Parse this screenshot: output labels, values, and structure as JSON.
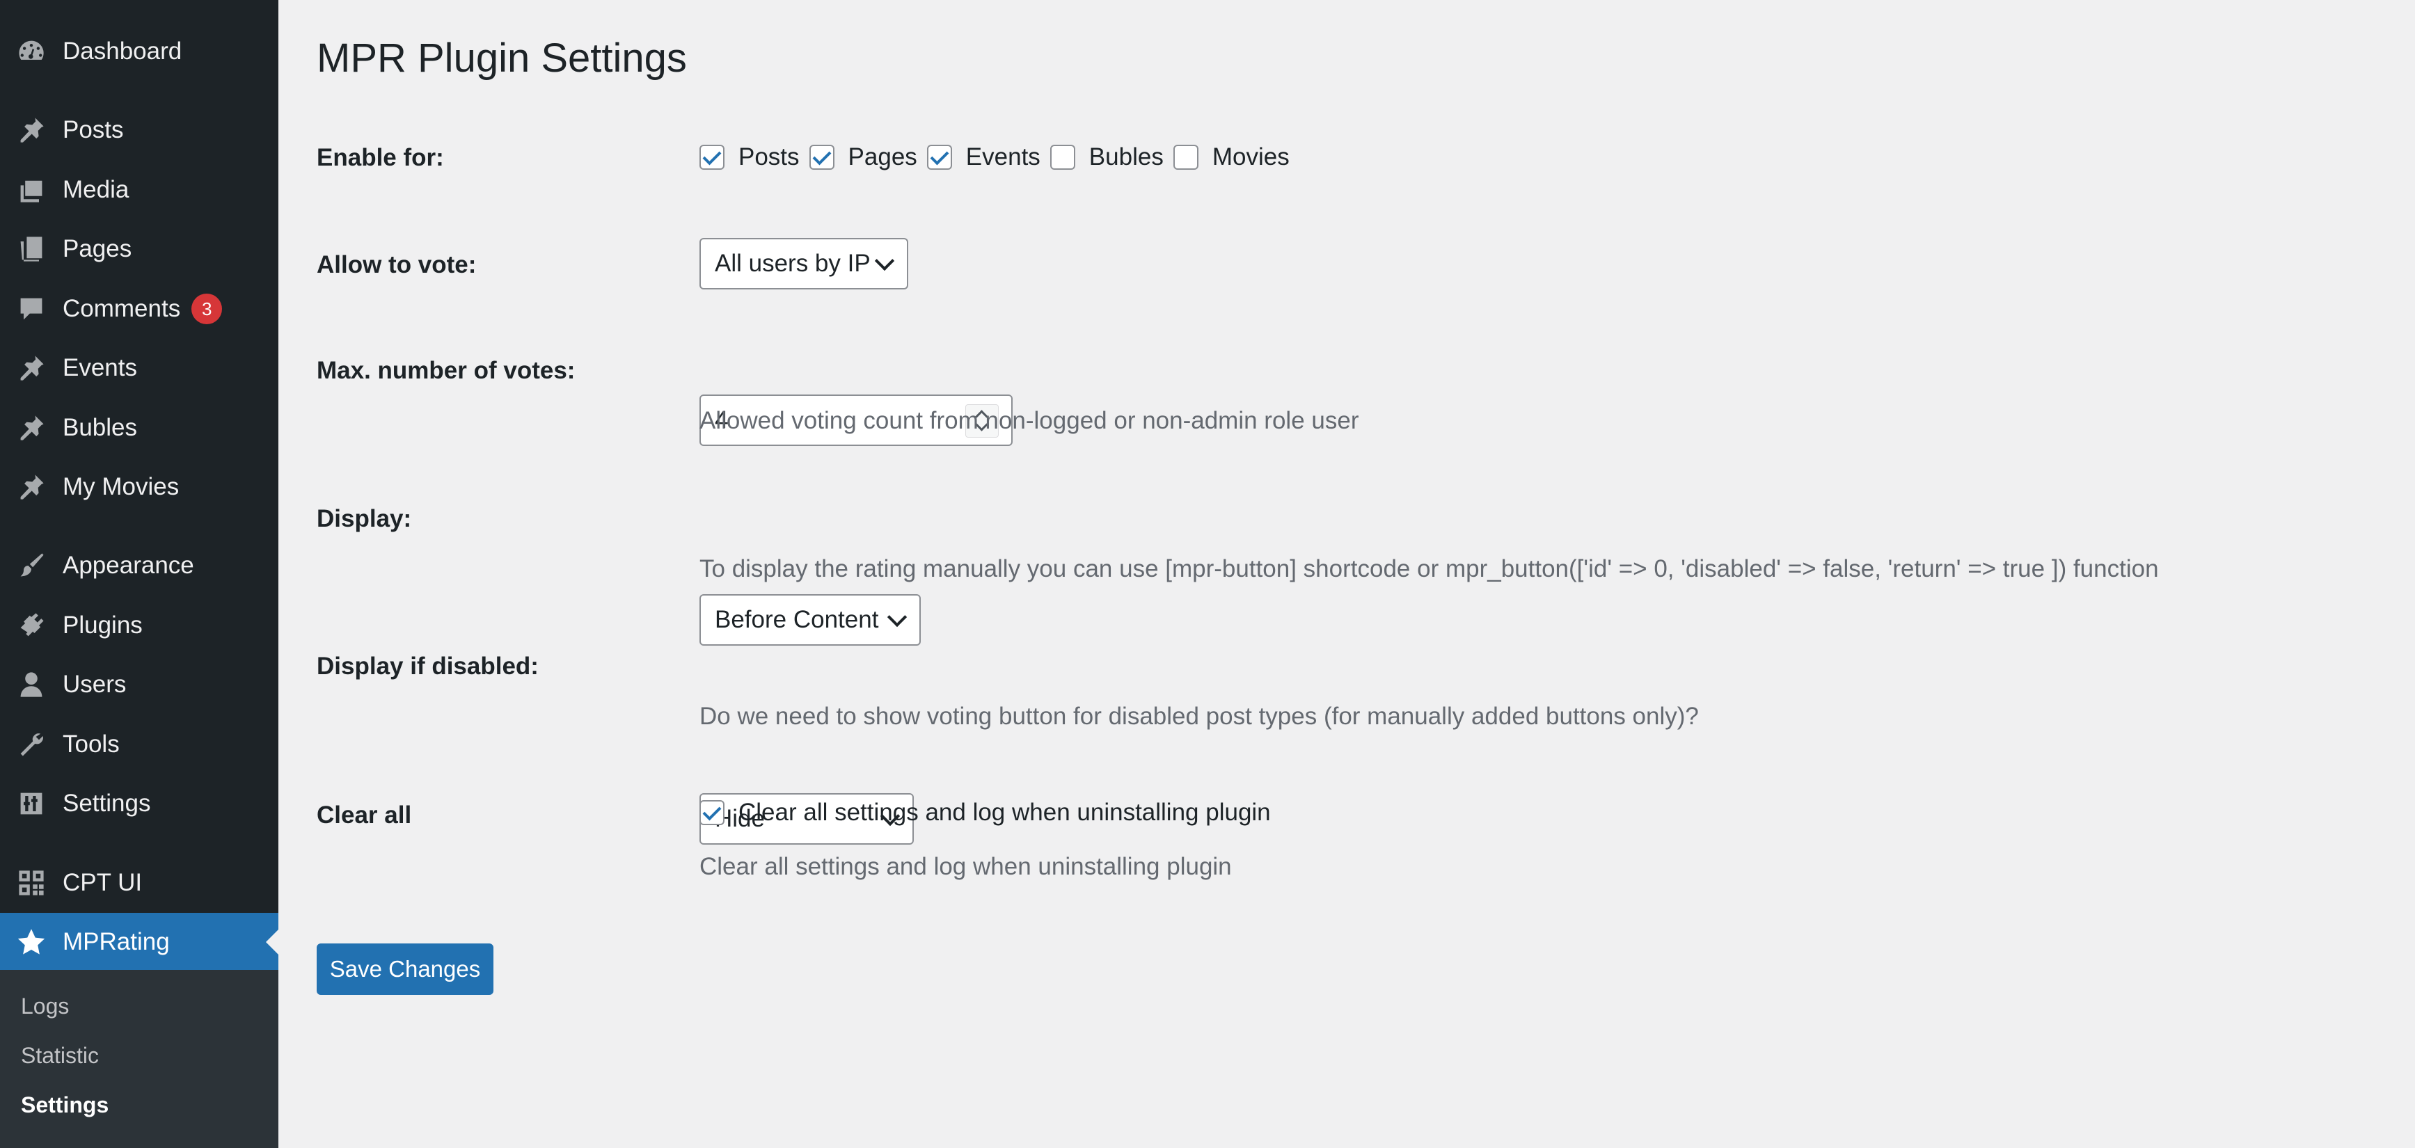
{
  "sidebar": {
    "items": [
      {
        "label": "Dashboard",
        "icon": "dashboard-icon"
      },
      {
        "label": "Posts",
        "icon": "pin-icon"
      },
      {
        "label": "Media",
        "icon": "media-icon"
      },
      {
        "label": "Pages",
        "icon": "pages-icon"
      },
      {
        "label": "Comments",
        "icon": "comment-icon",
        "badge": "3"
      },
      {
        "label": "Events",
        "icon": "pin-icon"
      },
      {
        "label": "Bubles",
        "icon": "pin-icon"
      },
      {
        "label": "My Movies",
        "icon": "pin-icon"
      },
      {
        "label": "Appearance",
        "icon": "brush-icon"
      },
      {
        "label": "Plugins",
        "icon": "plugin-icon"
      },
      {
        "label": "Users",
        "icon": "user-icon"
      },
      {
        "label": "Tools",
        "icon": "wrench-icon"
      },
      {
        "label": "Settings",
        "icon": "settings-icon"
      },
      {
        "label": "CPT UI",
        "icon": "grid-icon"
      },
      {
        "label": "MPRating",
        "icon": "star-icon",
        "current": true
      }
    ],
    "submenu": [
      {
        "label": "Logs"
      },
      {
        "label": "Statistic"
      },
      {
        "label": "Settings",
        "active": true
      }
    ]
  },
  "page": {
    "title": "MPR Plugin Settings",
    "enable_for": {
      "label": "Enable for:",
      "options": [
        {
          "label": "Posts",
          "checked": true
        },
        {
          "label": "Pages",
          "checked": true
        },
        {
          "label": "Events",
          "checked": true
        },
        {
          "label": "Bubles",
          "checked": false
        },
        {
          "label": "Movies",
          "checked": false
        }
      ]
    },
    "allow_to_vote": {
      "label": "Allow to vote:",
      "value": "All users by IP"
    },
    "max_votes": {
      "label": "Max. number of votes:",
      "value": "4",
      "description": "Allowed voting count from non-logged or non-admin role user"
    },
    "display": {
      "label": "Display:",
      "value": "Before Content",
      "description": "To display the rating manually you can use [mpr-button] shortcode or mpr_button(['id' => 0, 'disabled' => false, 'return' => true ]) function"
    },
    "display_if_disabled": {
      "label": "Display if disabled:",
      "value": "Hide",
      "description": "Do we need to show voting button for disabled post types (for manually added buttons only)?"
    },
    "clear_all": {
      "label": "Clear all",
      "checkbox_label": "Clear all settings and log when uninstalling plugin",
      "checked": true,
      "description": "Clear all settings and log when uninstalling plugin"
    },
    "save_label": "Save Changes"
  },
  "colors": {
    "accent": "#2271b1",
    "sidebar_bg": "#1d2327",
    "badge": "#d63638",
    "page_bg": "#f0f0f1"
  }
}
